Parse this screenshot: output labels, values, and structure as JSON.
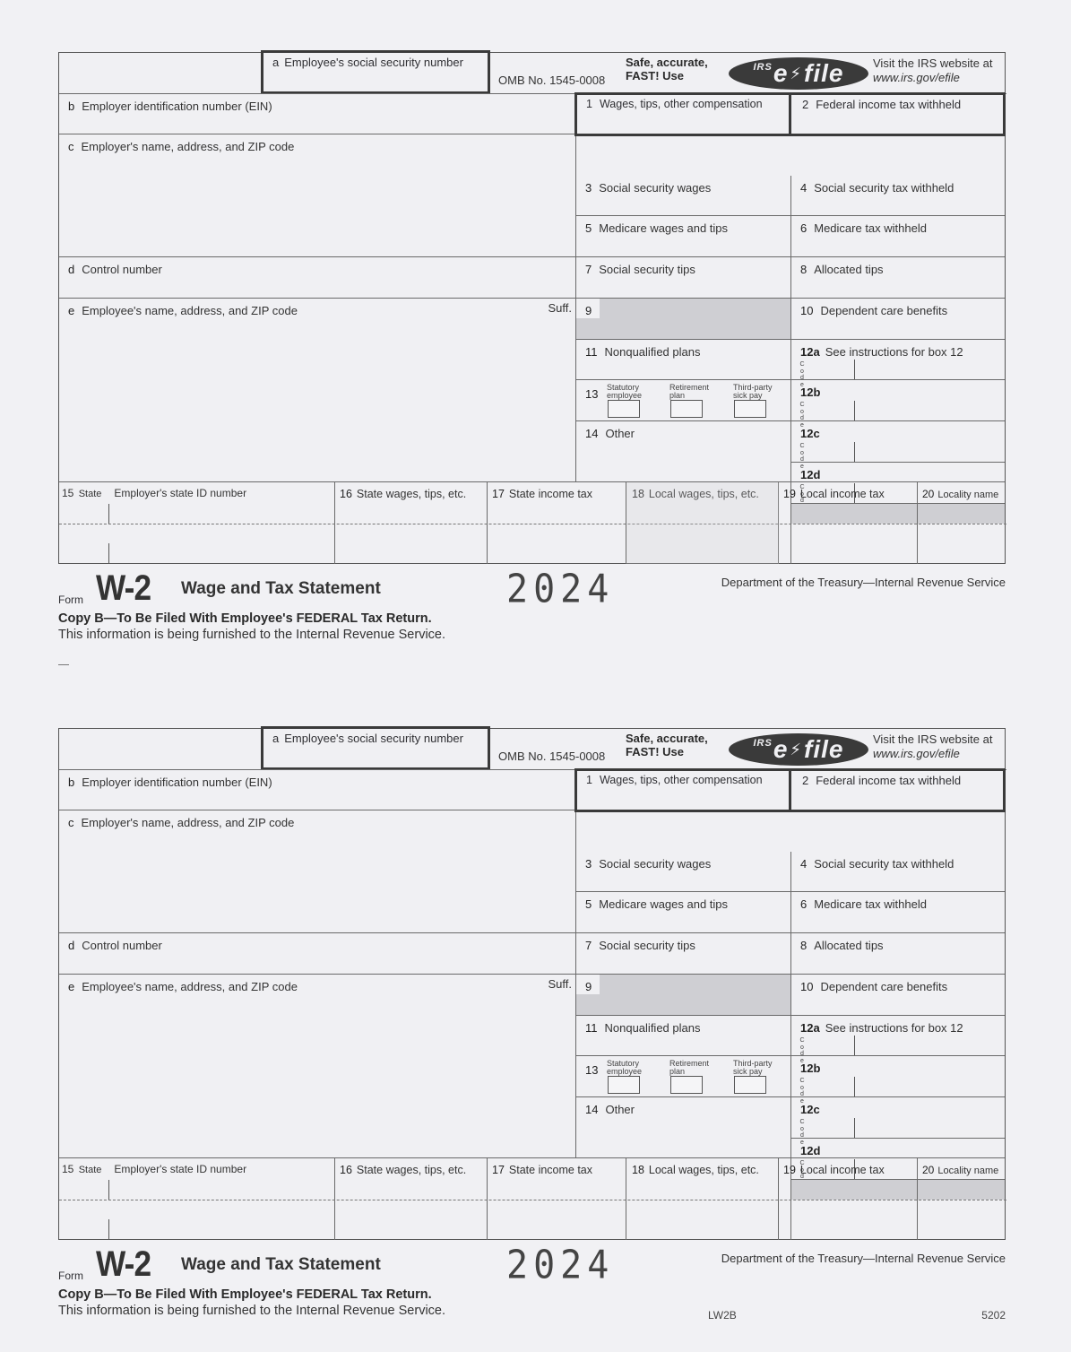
{
  "form": {
    "header": {
      "ssn_letter": "a",
      "ssn_label": "Employee's social security number",
      "omb": "OMB No. 1545-0008",
      "safe_line1": "Safe, accurate,",
      "safe_line2": "FAST! Use",
      "efile_irs": "IRS",
      "efile_e": "e",
      "efile_file": "file",
      "visit_line1": "Visit the IRS website at",
      "visit_line2": "www.irs.gov/efile"
    },
    "left_boxes": {
      "b": {
        "letter": "b",
        "label": "Employer identification number (EIN)"
      },
      "c": {
        "letter": "c",
        "label": "Employer's name, address, and ZIP code"
      },
      "d": {
        "letter": "d",
        "label": "Control number"
      },
      "e": {
        "letter": "e",
        "label": "Employee's name, address, and ZIP code",
        "suffix": "Suff."
      }
    },
    "boxes": {
      "b1": {
        "num": "1",
        "label": "Wages, tips, other compensation"
      },
      "b2": {
        "num": "2",
        "label": "Federal income tax withheld"
      },
      "b3": {
        "num": "3",
        "label": "Social security wages"
      },
      "b4": {
        "num": "4",
        "label": "Social security tax withheld"
      },
      "b5": {
        "num": "5",
        "label": "Medicare wages and tips"
      },
      "b6": {
        "num": "6",
        "label": "Medicare tax withheld"
      },
      "b7": {
        "num": "7",
        "label": "Social security tips"
      },
      "b8": {
        "num": "8",
        "label": "Allocated tips"
      },
      "b9": {
        "num": "9",
        "label": ""
      },
      "b10": {
        "num": "10",
        "label": "Dependent care benefits"
      },
      "b11": {
        "num": "11",
        "label": "Nonqualified plans"
      },
      "b12a": {
        "num": "12a",
        "label": "See instructions for box 12"
      },
      "b12b": {
        "num": "12b",
        "label": ""
      },
      "b12c": {
        "num": "12c",
        "label": ""
      },
      "b12d": {
        "num": "12d",
        "label": ""
      },
      "b13": {
        "num": "13",
        "statutory": "Statutory employee",
        "retirement": "Retirement plan",
        "thirdparty": "Third-party sick pay"
      },
      "b14": {
        "num": "14",
        "label": "Other"
      },
      "code_vertical": "C o d e"
    },
    "state_row": {
      "b15_num": "15",
      "b15_state": "State",
      "b15_label": "Employer's state ID number",
      "b16": {
        "num": "16",
        "label": "State wages, tips, etc."
      },
      "b17": {
        "num": "17",
        "label": "State income tax"
      },
      "b18": {
        "num": "18",
        "label": "Local wages, tips, etc."
      },
      "b19": {
        "num": "19",
        "label": "Local income tax"
      },
      "b20": {
        "num": "20",
        "label": "Locality name"
      }
    },
    "footer": {
      "form_word": "Form",
      "form_name": "W-2",
      "title": "Wage and Tax Statement",
      "year": "2024",
      "dept": "Department of the Treasury—Internal Revenue Service",
      "copy_b": "Copy B—To Be Filed With Employee's FEDERAL Tax Return.",
      "info": "This information is being furnished to the Internal Revenue Service."
    }
  },
  "bottom_extras": {
    "lw2b": "LW2B",
    "code_5202": "5202"
  }
}
